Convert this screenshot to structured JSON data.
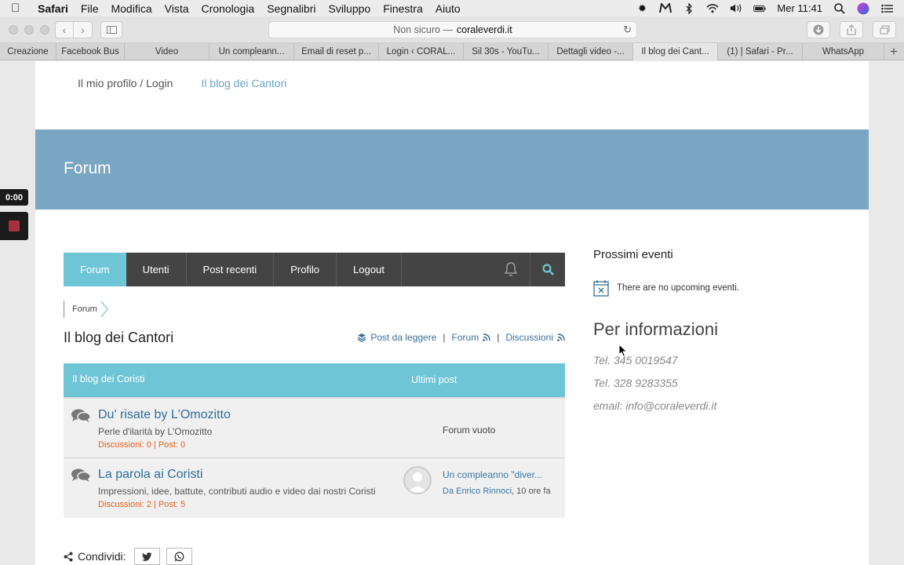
{
  "menubar": {
    "items": [
      "Safari",
      "File",
      "Modifica",
      "Vista",
      "Cronologia",
      "Segnalibri",
      "Sviluppo",
      "Finestra",
      "Aiuto"
    ],
    "clock": "Mer 11:41"
  },
  "browser": {
    "address_insecure": "Non sicuro —",
    "address_domain": "coraleverdi.it"
  },
  "tabs": [
    "Creazione",
    "Facebook Bus",
    "Video",
    "Un compleann...",
    "Email di reset p...",
    "Login ‹ CORAL...",
    "Sil 30s - YouTu...",
    "Dettagli video -...",
    "Il blog dei Cant...",
    "(1) | Safari - Pr...",
    "WhatsApp"
  ],
  "site": {
    "nav": [
      "Il mio profilo / Login",
      "Il blog dei Cantori"
    ],
    "hero_title": "Forum"
  },
  "forum": {
    "menu": [
      "Forum",
      "Utenti",
      "Post recenti",
      "Profilo",
      "Logout"
    ],
    "breadcrumb": "Forum",
    "title": "Il blog dei Cantori",
    "quick_links": [
      "Post da leggere",
      "Forum",
      "Discussioni"
    ],
    "quick_sep": "|",
    "table_head": [
      "Il blog dei Coristi",
      "Ultimi post"
    ],
    "rows": [
      {
        "name": "Du' risate by L'Omozitto",
        "desc": "Perle d'ilarità by L'Omozitto",
        "stats": "Discussioni: 0  |  Post: 0",
        "empty": "Forum vuoto"
      },
      {
        "name": "La parola ai Coristi",
        "desc": "Impressioni, idee, battute, contributi audio e video dai nostri Coristi",
        "stats": "Discussioni: 2  |  Post: 5",
        "last_post": "Un compleanno \"diver...",
        "last_by": "Da Enrico Rinnoci",
        "last_time": ", 10 ore fa"
      }
    ],
    "share_label": "Condividi:"
  },
  "sidebar": {
    "events_title": "Prossimi eventi",
    "no_events": "There are no upcoming eventi.",
    "info_title": "Per informazioni",
    "info_lines": [
      "Tel. 345 0019547",
      "Tel. 328 9283355",
      "email: info@coraleverdi.it"
    ]
  },
  "overlay": {
    "timer": "0:00"
  },
  "colors": {
    "hero": "#79a6c3",
    "accent": "#6ec5d6",
    "dark_nav": "#444444",
    "stats": "#e8601c",
    "link": "#2f6f98"
  }
}
